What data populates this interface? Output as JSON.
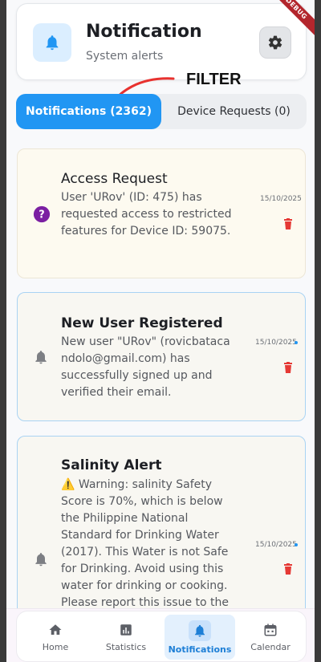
{
  "header": {
    "title": "Notification",
    "subtitle": "System alerts",
    "icon": "bell-icon",
    "settings_icon": "gear-icon"
  },
  "debug_banner": "DEBUG",
  "annotation": {
    "label": "FILTER"
  },
  "tabs": [
    {
      "label": "Notifications (2362)",
      "active": true
    },
    {
      "label": "Device Requests (0)",
      "active": false
    }
  ],
  "notifications": [
    {
      "title": "Access Request",
      "body": "User 'URov' (ID: 475) has requested access to restricted features for Device ID: 59075.",
      "date": "15/10/2025",
      "icon": "question-circle-icon",
      "unread": false
    },
    {
      "title": "New User Registered",
      "body": "New user \"URov\" (rovicbataca ndolo@gmail.com) has successfully signed up and verified their email.",
      "date": "15/10/2025",
      "icon": "bell-icon",
      "unread": true
    },
    {
      "title": "Salinity Alert",
      "body": "⚠️ Warning: salinity Safety Score is 70%, which is below the Philippine National Standard for Drinking Water (2017). This Water is not Safe for Drinking. Avoid using this water for drinking or cooking. Please report this issue to the",
      "date": "15/10/2025",
      "icon": "bell-icon",
      "unread": true
    }
  ],
  "bottom_nav": [
    {
      "label": "Home",
      "icon": "home-icon",
      "active": false
    },
    {
      "label": "Statistics",
      "icon": "chart-icon",
      "active": false
    },
    {
      "label": "Notifications",
      "icon": "bell-icon",
      "active": true
    },
    {
      "label": "Calendar",
      "icon": "calendar-icon",
      "active": false
    }
  ],
  "colors": {
    "primary": "#2196f3",
    "alert_red": "#e53935",
    "annotation_red": "#e8322f",
    "question_purple": "#7b1fa2"
  }
}
